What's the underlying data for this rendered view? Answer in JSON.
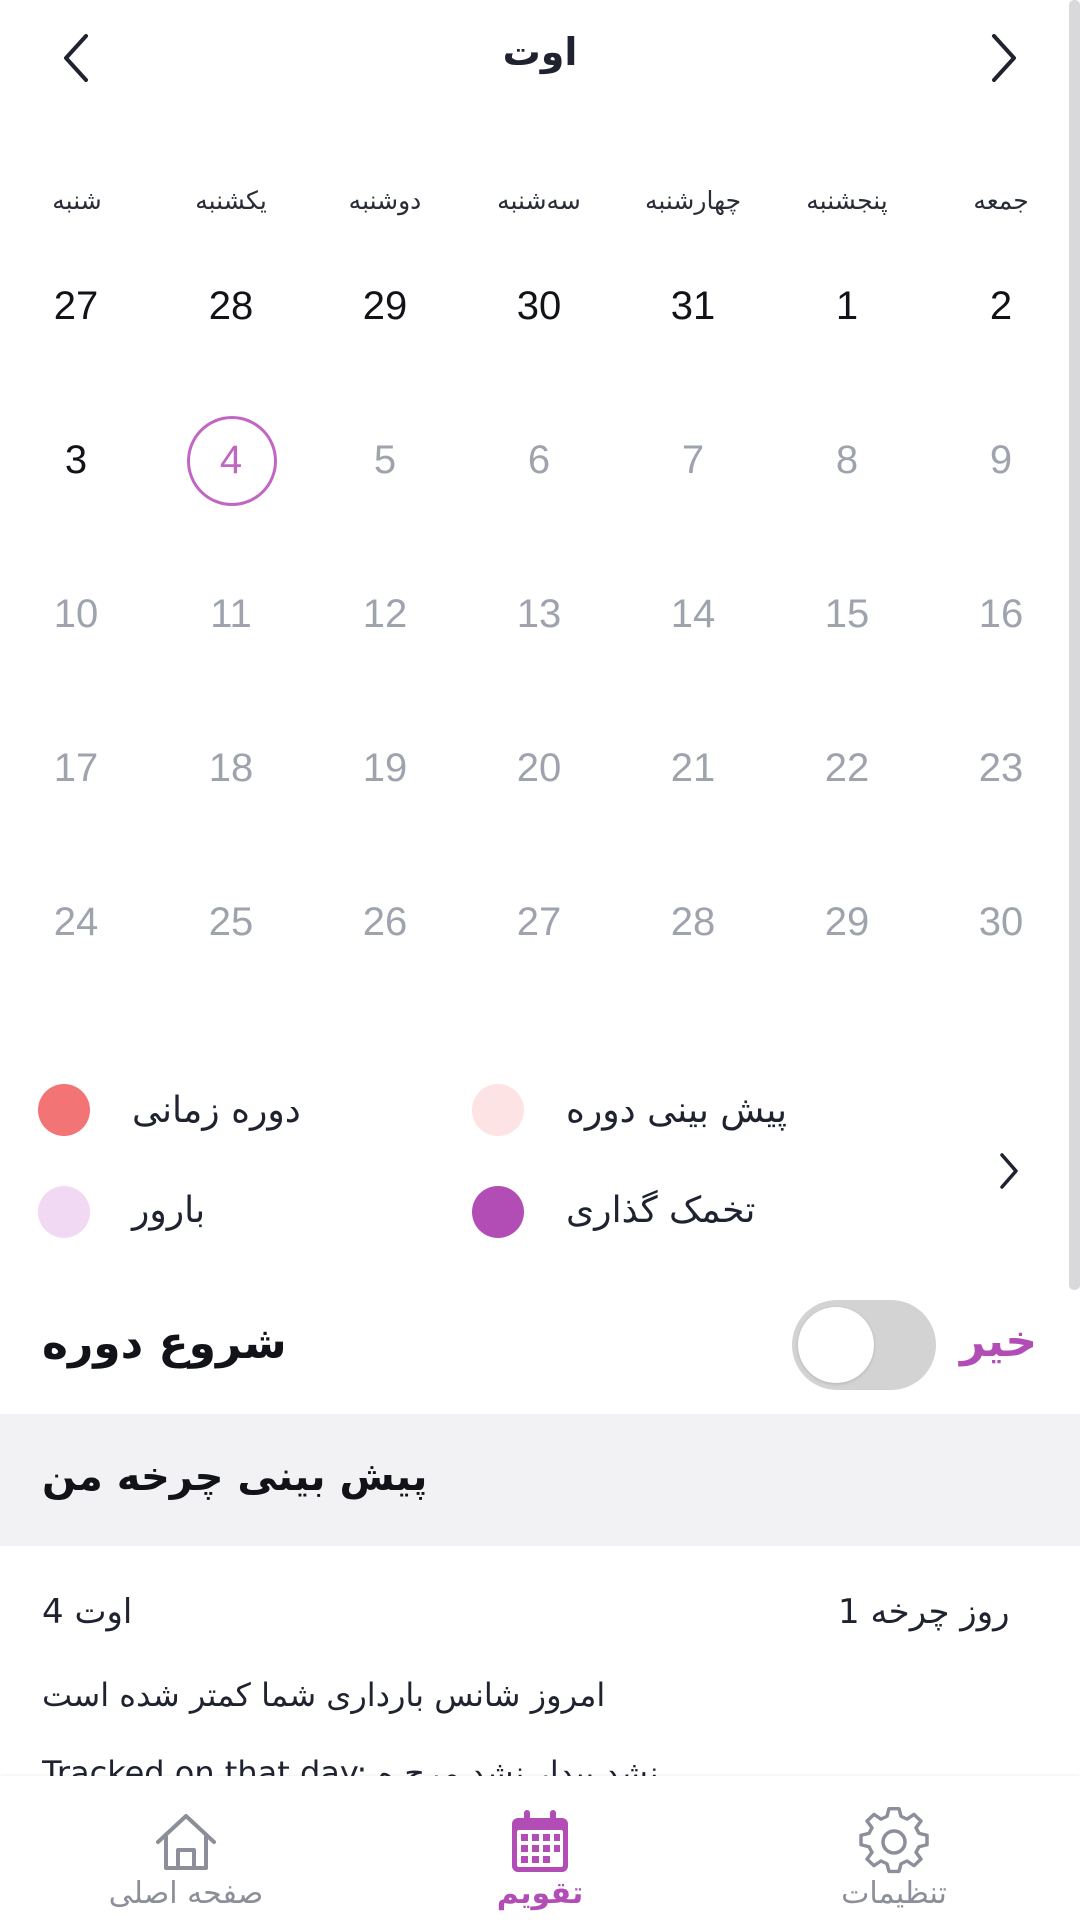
{
  "header": {
    "month_title": "اوت"
  },
  "weekdays": [
    "شنبه",
    "یکشنبه",
    "دوشنبه",
    "سه‌شنبه",
    "چهارشنبه",
    "پنجشنبه",
    "جمعه"
  ],
  "weeks": [
    [
      {
        "d": "27",
        "state": "active"
      },
      {
        "d": "28",
        "state": "active"
      },
      {
        "d": "29",
        "state": "active"
      },
      {
        "d": "30",
        "state": "active"
      },
      {
        "d": "31",
        "state": "active"
      },
      {
        "d": "1",
        "state": "active"
      },
      {
        "d": "2",
        "state": "active"
      }
    ],
    [
      {
        "d": "3",
        "state": "active"
      },
      {
        "d": "4",
        "state": "today"
      },
      {
        "d": "5",
        "state": "future"
      },
      {
        "d": "6",
        "state": "future"
      },
      {
        "d": "7",
        "state": "future"
      },
      {
        "d": "8",
        "state": "future"
      },
      {
        "d": "9",
        "state": "future"
      }
    ],
    [
      {
        "d": "10",
        "state": "future"
      },
      {
        "d": "11",
        "state": "future"
      },
      {
        "d": "12",
        "state": "future"
      },
      {
        "d": "13",
        "state": "future"
      },
      {
        "d": "14",
        "state": "future"
      },
      {
        "d": "15",
        "state": "future"
      },
      {
        "d": "16",
        "state": "future"
      }
    ],
    [
      {
        "d": "17",
        "state": "future"
      },
      {
        "d": "18",
        "state": "future"
      },
      {
        "d": "19",
        "state": "future"
      },
      {
        "d": "20",
        "state": "future"
      },
      {
        "d": "21",
        "state": "future"
      },
      {
        "d": "22",
        "state": "future"
      },
      {
        "d": "23",
        "state": "future"
      }
    ],
    [
      {
        "d": "24",
        "state": "future"
      },
      {
        "d": "25",
        "state": "future"
      },
      {
        "d": "26",
        "state": "future"
      },
      {
        "d": "27",
        "state": "future"
      },
      {
        "d": "28",
        "state": "future"
      },
      {
        "d": "29",
        "state": "future"
      },
      {
        "d": "30",
        "state": "future"
      }
    ]
  ],
  "legend": {
    "period": {
      "label": "دوره زمانی",
      "color": "#f27474"
    },
    "period_prediction": {
      "label": "پیش بینی دوره",
      "color": "#fde3e3"
    },
    "fertile": {
      "label": "بارور",
      "color": "#f2d9f3"
    },
    "ovulation": {
      "label": "تخمک گذاری",
      "color": "#b14db5"
    }
  },
  "period_start": {
    "title": "شروع دوره",
    "toggle_state_label": "خیر",
    "toggle_on": false
  },
  "prediction": {
    "title": "پیش بینی چرخه من",
    "date": "4 اوت",
    "cycle_day": "روز چرخه 1",
    "chance_text": "امروز شانس بارداری شما کمتر شده است",
    "tracked_text": "Tracked on that day: نشد بیدار نشد مرح ه"
  },
  "bottom_nav": {
    "home": "صفحه اصلی",
    "calendar": "تقویم",
    "settings": "تنظیمات"
  },
  "colors": {
    "accent": "#b14db5",
    "today_ring": "#c067c4"
  }
}
